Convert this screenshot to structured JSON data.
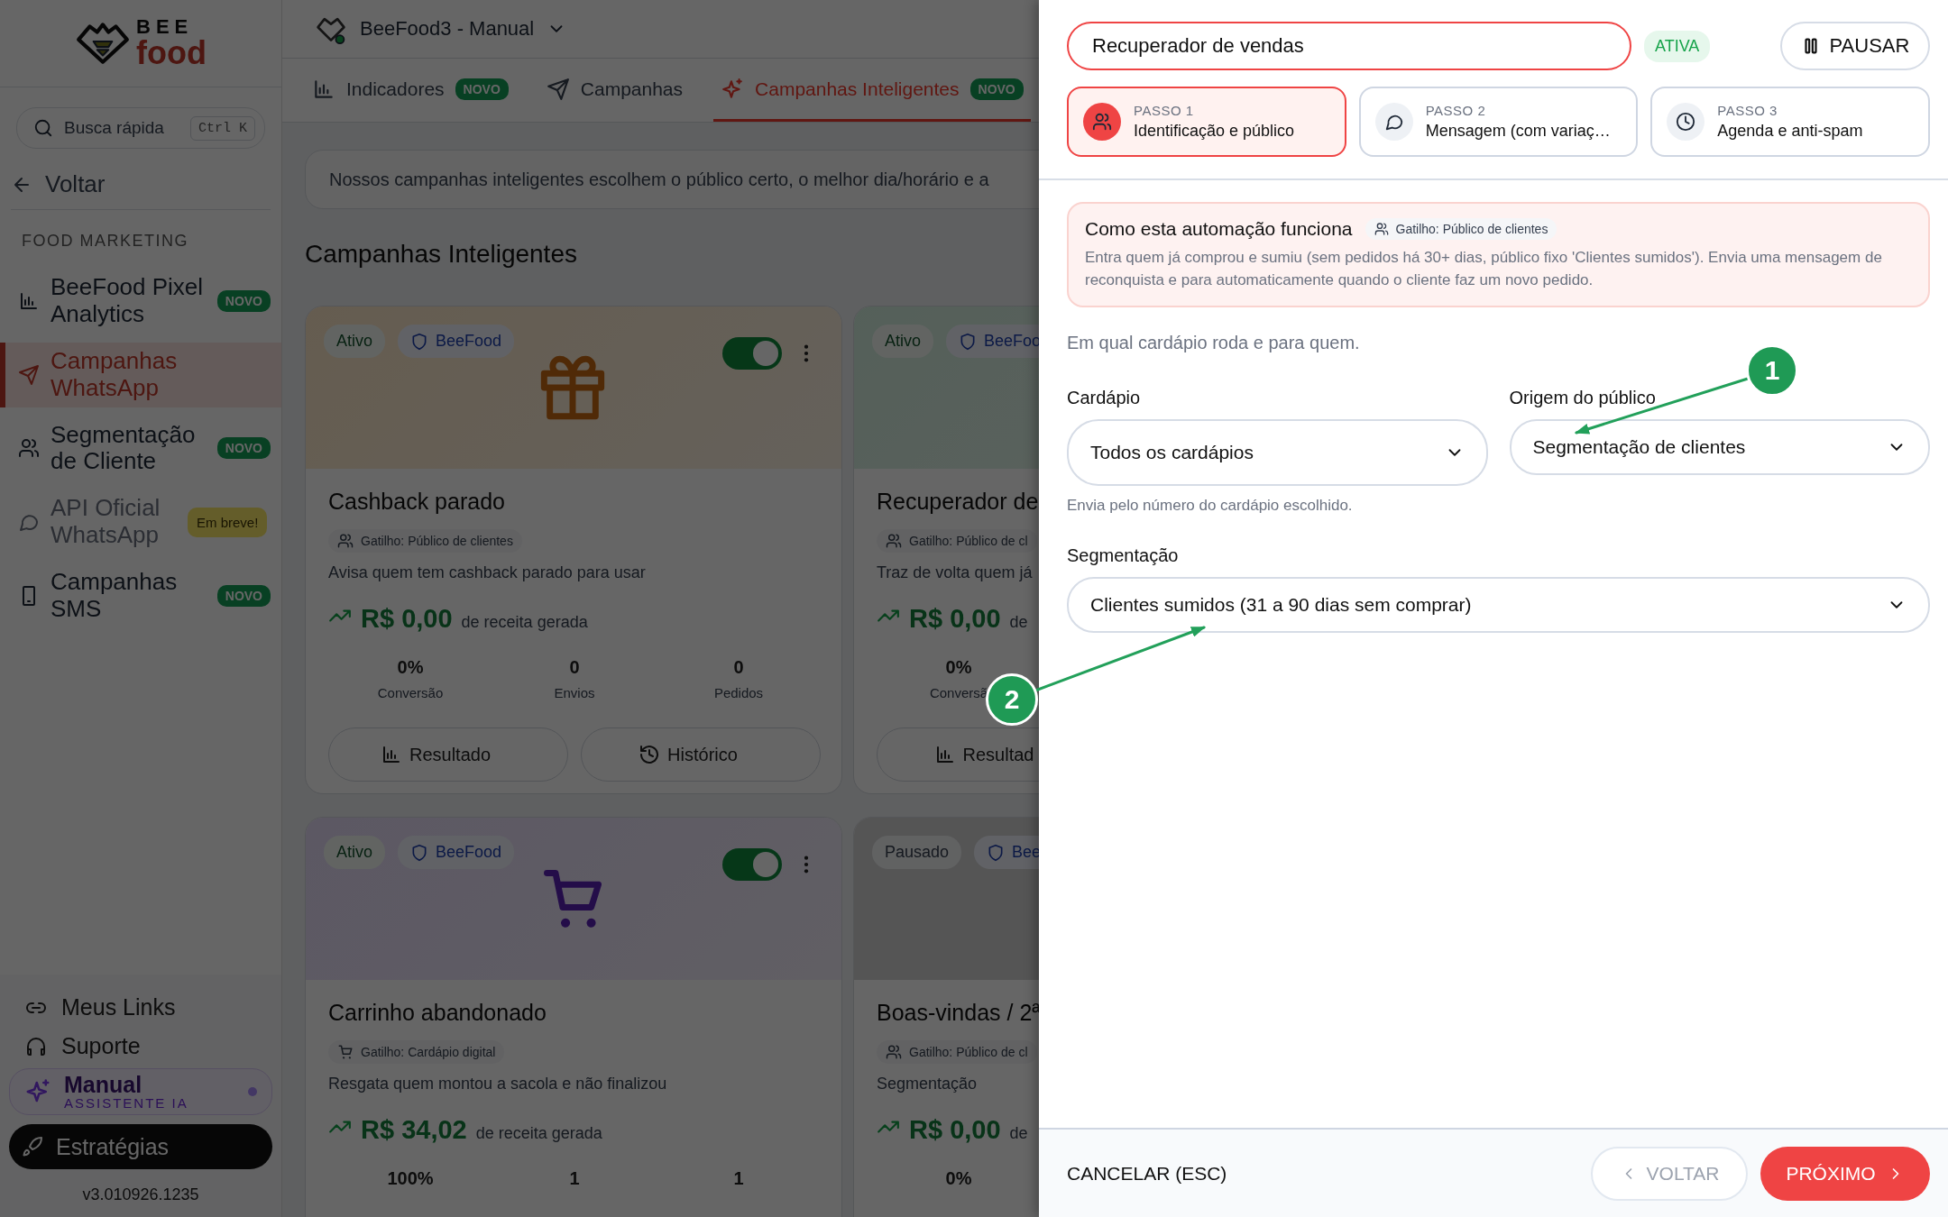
{
  "sidebar": {
    "logo": {
      "line1": "BEE",
      "line2": "food"
    },
    "search": {
      "placeholder": "Busca rápida",
      "shortcut": "Ctrl K"
    },
    "back": "Voltar",
    "section": "FOOD MARKETING",
    "items": [
      {
        "label": "BeeFood Pixel Analytics",
        "badge": {
          "text": "NOVO",
          "kind": "new"
        },
        "selected": false,
        "disabled": false
      },
      {
        "label": "Campanhas WhatsApp",
        "selected": true,
        "disabled": false
      },
      {
        "label": "Segmentação de Cliente",
        "badge": {
          "text": "NOVO",
          "kind": "new"
        },
        "selected": false,
        "disabled": false
      },
      {
        "label": "API Oficial WhatsApp",
        "badge": {
          "text": "Em breve!",
          "kind": "soon"
        },
        "selected": false,
        "disabled": true
      },
      {
        "label": "Campanhas SMS",
        "badge": {
          "text": "NOVO",
          "kind": "new"
        },
        "selected": false,
        "disabled": false
      }
    ],
    "footer_links": [
      {
        "label": "Meus Links"
      },
      {
        "label": "Suporte"
      }
    ],
    "assistant": {
      "name": "Manual",
      "subtitle": "ASSISTENTE IA"
    },
    "strategies_button": "Estratégias",
    "version": "v3.010926.1235"
  },
  "header": {
    "account": "BeeFood3 - Manual"
  },
  "tabs": [
    {
      "label": "Indicadores",
      "badge": "NOVO",
      "selected": false
    },
    {
      "label": "Campanhas",
      "selected": false
    },
    {
      "label": "Campanhas Inteligentes",
      "badge": "NOVO",
      "selected": true
    }
  ],
  "banner": "Nossos campanhas inteligentes escolhem o público certo, o melhor dia/horário e a",
  "section_title": "Campanhas Inteligentes",
  "cards": [
    {
      "status": {
        "text": "Ativo",
        "active": true
      },
      "brand": "BeeFood",
      "toggle": {
        "on": true
      },
      "title": "Cashback parado",
      "trigger": "Gatilho: Público de clientes",
      "description": "Avisa quem tem cashback parado para usar",
      "revenue": "R$ 0,00",
      "revenue_label": "de receita gerada",
      "stats": [
        {
          "value": "0%",
          "label": "Conversão"
        },
        {
          "value": "0",
          "label": "Envios"
        },
        {
          "value": "0",
          "label": "Pedidos"
        }
      ],
      "buttons": [
        "Resultado",
        "Histórico"
      ]
    },
    {
      "status": {
        "text": "Ativo",
        "active": true
      },
      "brand": "BeeFoo",
      "title": "Recuperador de",
      "trigger": "Gatilho: Público de cl",
      "description": "Traz de volta quem já",
      "revenue": "R$ 0,00",
      "revenue_label": "de",
      "stats": [
        {
          "value": "0%",
          "label": "Conversã"
        }
      ],
      "buttons": [
        "Resultad"
      ]
    },
    {
      "status": {
        "text": "Ativo",
        "active": true
      },
      "brand": "BeeFood",
      "toggle": {
        "on": true
      },
      "title": "Carrinho abandonado",
      "trigger": "Gatilho: Cardápio digital",
      "description": "Resgata quem montou a sacola e não finalizou",
      "revenue": "R$ 34,02",
      "revenue_label": "de receita gerada",
      "stats": [
        {
          "value": "100%"
        },
        {
          "value": "1"
        },
        {
          "value": "1"
        }
      ]
    },
    {
      "status": {
        "text": "Pausado",
        "active": false
      },
      "brand": "Bee",
      "title": "Boas-vindas / 2ª",
      "trigger": "Gatilho: Público de cl",
      "description": "Segmentação",
      "revenue": "R$ 0,00",
      "revenue_label": "de",
      "stats": [
        {
          "value": "0%"
        }
      ]
    }
  ],
  "drawer": {
    "name": "Recuperador de vendas",
    "status": "ATIVA",
    "pause_button": "PAUSAR",
    "steps": [
      {
        "label": "PASSO 1",
        "title": "Identificação e público",
        "selected": true
      },
      {
        "label": "PASSO 2",
        "title": "Mensagem (com variaç…",
        "selected": false
      },
      {
        "label": "PASSO 3",
        "title": "Agenda e anti-spam",
        "selected": false
      }
    ],
    "info": {
      "title": "Como esta automação funciona",
      "trigger": "Gatilho: Público de clientes",
      "text": "Entra quem já comprou e sumiu (sem pedidos há 30+ dias, público fixo 'Clientes sumidos'). Envia uma mensagem de reconquista e para automaticamente quando o cliente faz um novo pedido."
    },
    "intro": "Em qual cardápio roda e para quem.",
    "fields": [
      {
        "label": "Cardápio",
        "value": "Todos os cardápios",
        "hint": "Envia pelo número do cardápio escolhido.",
        "wide": false
      },
      {
        "label": "Origem do público",
        "value": "Segmentação de clientes",
        "wide": false
      },
      {
        "label": "Segmentação",
        "value": "Clientes sumidos (31 a 90 dias sem comprar)",
        "wide": true
      }
    ],
    "footer": {
      "cancel": "CANCELAR (ESC)",
      "back": {
        "label": "VOLTAR",
        "disabled": true
      },
      "next": "PRÓXIMO"
    }
  },
  "annotations": [
    {
      "label": "1"
    },
    {
      "label": "2"
    }
  ]
}
